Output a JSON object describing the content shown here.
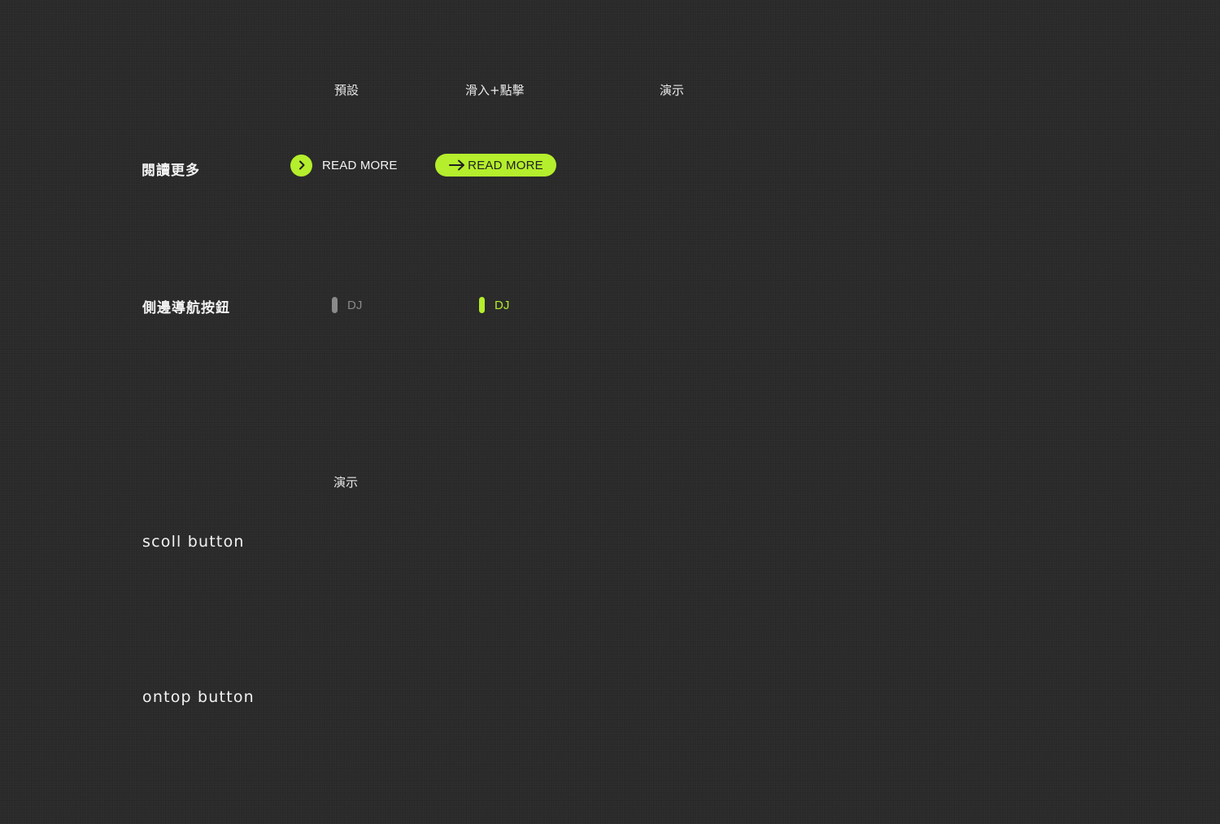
{
  "columns": {
    "default": "預設",
    "hover_click": "滑入+點擊",
    "demo": "演示"
  },
  "rows": {
    "read_more": "閱讀更多",
    "side_nav": "側邊導航按鈕",
    "scroll": "scoll button",
    "ontop": "ontop button"
  },
  "read_more_button": {
    "label": "READ MORE",
    "hover_label": "READ MORE"
  },
  "side_nav_button": {
    "label": "DJ",
    "hover_label": "DJ"
  },
  "scroll_section": {
    "demo_header": "演示"
  },
  "icons": {
    "read_more_default": "chevron-right-icon",
    "read_more_hover": "arrow-right-icon"
  },
  "colors": {
    "accent": "#b4ee2c",
    "background": "#2a2a2a",
    "muted": "#8a8a8a"
  }
}
